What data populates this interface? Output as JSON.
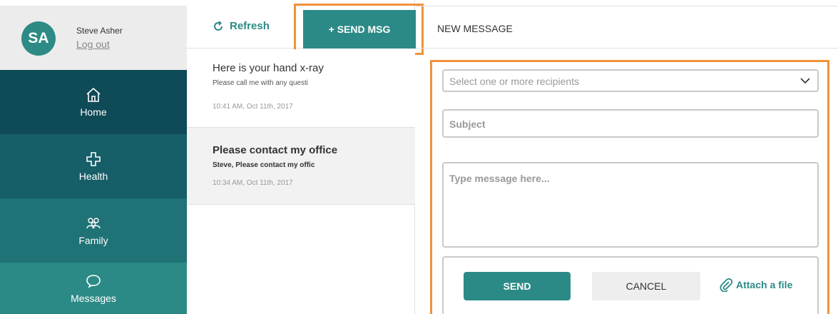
{
  "user": {
    "initials": "SA",
    "name": "Steve Asher",
    "logout": "Log out"
  },
  "nav": {
    "home": "Home",
    "health": "Health",
    "family": "Family",
    "messages": "Messages"
  },
  "toolbar": {
    "refresh": "Refresh",
    "send_msg": "+ SEND MSG"
  },
  "messages": [
    {
      "title": "Here is your hand x-ray",
      "preview": "Please call me with any questi",
      "time": "10:41 AM, Oct 11th, 2017"
    },
    {
      "title": "Please contact my office",
      "preview": "Steve, Please contact my offic",
      "time": "10:34 AM, Oct 11th, 2017"
    }
  ],
  "compose": {
    "header": "NEW MESSAGE",
    "recipients_placeholder": "Select one or more recipients",
    "subject_placeholder": "Subject",
    "body_placeholder": "Type message here...",
    "send": "SEND",
    "cancel": "CANCEL",
    "attach": "Attach a file"
  },
  "colors": {
    "accent": "#2c8a86",
    "highlight": "#f0923a"
  }
}
